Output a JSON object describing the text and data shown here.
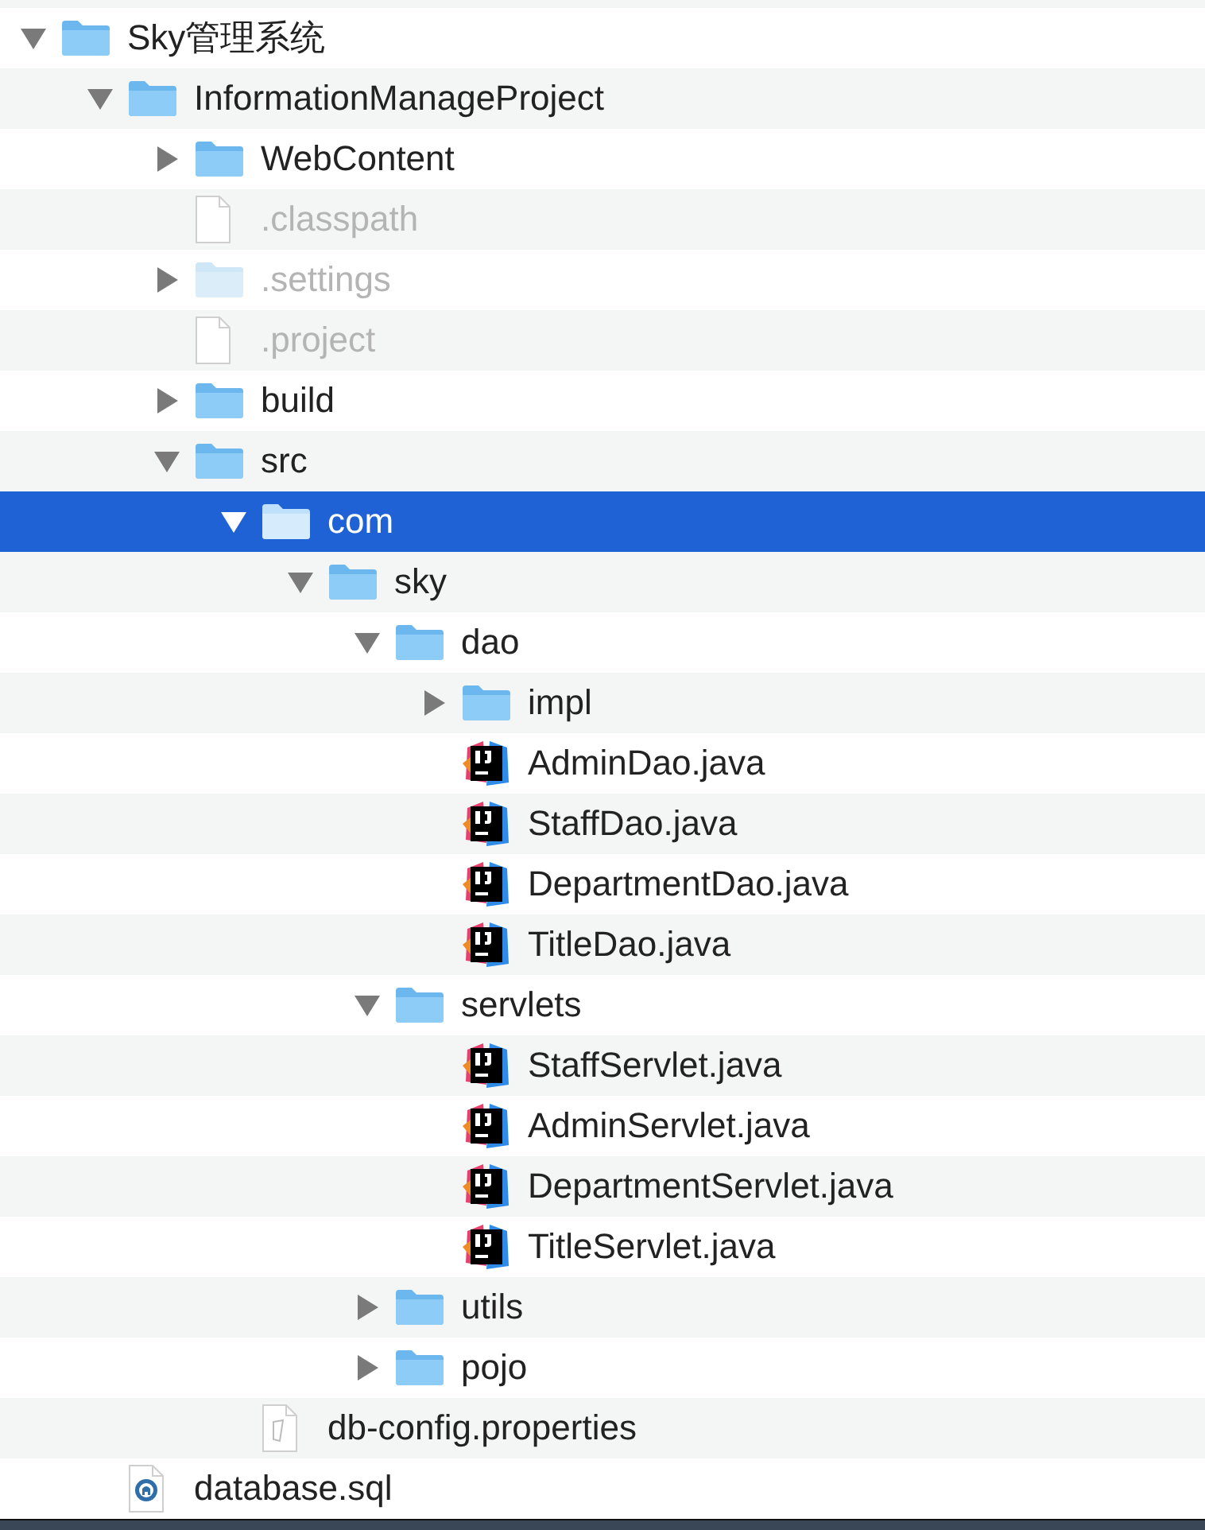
{
  "tree": [
    {
      "name": "Sky管理系统",
      "kind": "folder",
      "expanded": true,
      "selected": false,
      "dimmed": false,
      "children": [
        {
          "name": "InformationManageProject",
          "kind": "folder",
          "expanded": true,
          "selected": false,
          "dimmed": false,
          "children": [
            {
              "name": "WebContent",
              "kind": "folder",
              "expanded": false,
              "selected": false,
              "dimmed": false
            },
            {
              "name": ".classpath",
              "kind": "file",
              "selected": false,
              "dimmed": true
            },
            {
              "name": ".settings",
              "kind": "folder",
              "expanded": false,
              "selected": false,
              "dimmed": true
            },
            {
              "name": ".project",
              "kind": "file",
              "selected": false,
              "dimmed": true
            },
            {
              "name": "build",
              "kind": "folder",
              "expanded": false,
              "selected": false,
              "dimmed": false
            },
            {
              "name": "src",
              "kind": "folder",
              "expanded": true,
              "selected": false,
              "dimmed": false,
              "children": [
                {
                  "name": "com",
                  "kind": "folder",
                  "expanded": true,
                  "selected": true,
                  "dimmed": false,
                  "children": [
                    {
                      "name": "sky",
                      "kind": "folder",
                      "expanded": true,
                      "selected": false,
                      "dimmed": false,
                      "children": [
                        {
                          "name": "dao",
                          "kind": "folder",
                          "expanded": true,
                          "selected": false,
                          "dimmed": false,
                          "children": [
                            {
                              "name": "impl",
                              "kind": "folder",
                              "expanded": false,
                              "selected": false,
                              "dimmed": false
                            },
                            {
                              "name": "AdminDao.java",
                              "kind": "java",
                              "selected": false,
                              "dimmed": false
                            },
                            {
                              "name": "StaffDao.java",
                              "kind": "java",
                              "selected": false,
                              "dimmed": false
                            },
                            {
                              "name": "DepartmentDao.java",
                              "kind": "java",
                              "selected": false,
                              "dimmed": false
                            },
                            {
                              "name": "TitleDao.java",
                              "kind": "java",
                              "selected": false,
                              "dimmed": false
                            }
                          ]
                        },
                        {
                          "name": "servlets",
                          "kind": "folder",
                          "expanded": true,
                          "selected": false,
                          "dimmed": false,
                          "children": [
                            {
                              "name": "StaffServlet.java",
                              "kind": "java",
                              "selected": false,
                              "dimmed": false
                            },
                            {
                              "name": "AdminServlet.java",
                              "kind": "java",
                              "selected": false,
                              "dimmed": false
                            },
                            {
                              "name": "DepartmentServlet.java",
                              "kind": "java",
                              "selected": false,
                              "dimmed": false
                            },
                            {
                              "name": "TitleServlet.java",
                              "kind": "java",
                              "selected": false,
                              "dimmed": false
                            }
                          ]
                        },
                        {
                          "name": "utils",
                          "kind": "folder",
                          "expanded": false,
                          "selected": false,
                          "dimmed": false
                        },
                        {
                          "name": "pojo",
                          "kind": "folder",
                          "expanded": false,
                          "selected": false,
                          "dimmed": false
                        }
                      ]
                    }
                  ]
                },
                {
                  "name": "db-config.properties",
                  "kind": "properties",
                  "selected": false,
                  "dimmed": false
                }
              ]
            }
          ]
        },
        {
          "name": "database.sql",
          "kind": "sql",
          "selected": false,
          "dimmed": false
        }
      ]
    }
  ]
}
